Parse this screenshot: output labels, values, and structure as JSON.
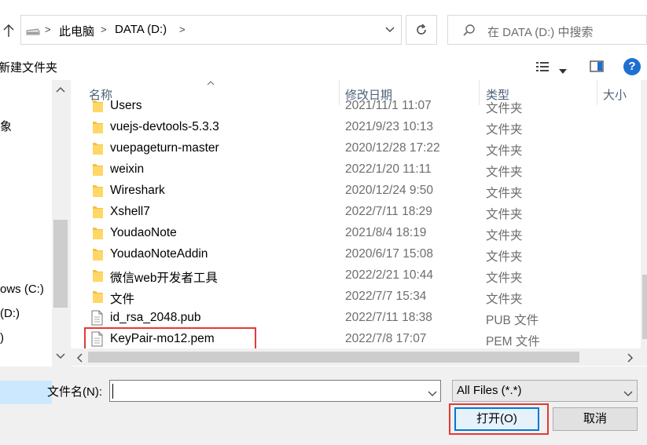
{
  "address": {
    "crumbs": [
      "此电脑",
      "DATA (D:)"
    ],
    "search_placeholder": "在 DATA (D:) 中搜索"
  },
  "toolbar": {
    "new_folder": "新建文件夹"
  },
  "nav": {
    "items": [
      "象",
      "ows (C:)",
      " (D:)",
      ")"
    ]
  },
  "columns": {
    "name": "名称",
    "date": "修改日期",
    "type": "类型",
    "size": "大小"
  },
  "files": [
    {
      "name": "Users",
      "date": "2021/11/1 11:07",
      "type": "文件夹",
      "kind": "folder"
    },
    {
      "name": "vuejs-devtools-5.3.3",
      "date": "2021/9/23 10:13",
      "type": "文件夹",
      "kind": "folder"
    },
    {
      "name": "vuepageturn-master",
      "date": "2020/12/28 17:22",
      "type": "文件夹",
      "kind": "folder"
    },
    {
      "name": "weixin",
      "date": "2022/1/20 11:11",
      "type": "文件夹",
      "kind": "folder"
    },
    {
      "name": "Wireshark",
      "date": "2020/12/24 9:50",
      "type": "文件夹",
      "kind": "folder"
    },
    {
      "name": "Xshell7",
      "date": "2022/7/11 18:29",
      "type": "文件夹",
      "kind": "folder"
    },
    {
      "name": "YoudaoNote",
      "date": "2021/8/4 18:19",
      "type": "文件夹",
      "kind": "folder"
    },
    {
      "name": "YoudaoNoteAddin",
      "date": "2020/6/17 15:08",
      "type": "文件夹",
      "kind": "folder"
    },
    {
      "name": "微信web开发者工具",
      "date": "2022/2/21 10:44",
      "type": "文件夹",
      "kind": "folder"
    },
    {
      "name": "文件",
      "date": "2022/7/7 15:34",
      "type": "文件夹",
      "kind": "folder"
    },
    {
      "name": "id_rsa_2048.pub",
      "date": "2022/7/11 18:38",
      "type": "PUB 文件",
      "kind": "file"
    },
    {
      "name": "KeyPair-mo12.pem",
      "date": "2022/7/8 17:07",
      "type": "PEM 文件",
      "kind": "file"
    }
  ],
  "bottom": {
    "filename_label": "文件名(N):",
    "filename_value": "",
    "filter": "All Files (*.*)",
    "open": "打开(O)",
    "cancel": "取消"
  },
  "colors": {
    "highlight": "#e53935",
    "accent": "#0078d7",
    "folder": "#f4c042"
  }
}
